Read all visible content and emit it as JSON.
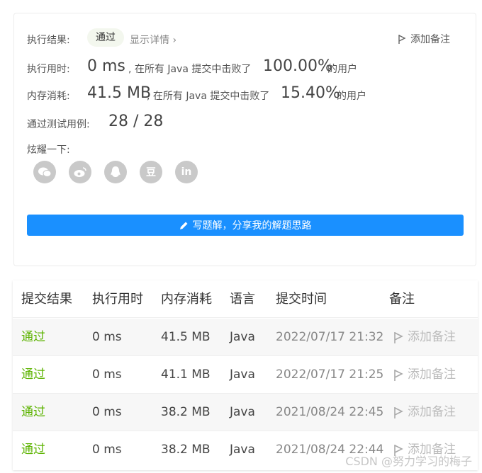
{
  "summary": {
    "result_label": "执行结果:",
    "result_badge": "通过",
    "details_link": "显示详情",
    "add_note": "添加备注",
    "runtime_label": "执行用时:",
    "runtime_value": "0 ms",
    "runtime_text": ", 在所有 Java 提交中击败了",
    "runtime_percent": "100.00%",
    "runtime_suffix": "的用户",
    "memory_label": "内存消耗:",
    "memory_value": "41.5 MB",
    "memory_text": ", 在所有 Java 提交中击败了",
    "memory_percent": "15.40%",
    "memory_suffix": "的用户",
    "tests_label": "通过测试用例:",
    "tests_value": "28 / 28",
    "share_label": "炫耀一下:",
    "share_icons": [
      "wechat-icon",
      "weibo-icon",
      "qq-icon",
      "douban-icon",
      "linkedin-icon"
    ],
    "share_glyphs": [
      "",
      "",
      "",
      "豆",
      "in"
    ],
    "cta_label": "写题解，分享我的解题思路"
  },
  "table": {
    "headers": [
      "提交结果",
      "执行用时",
      "内存消耗",
      "语言",
      "提交时间",
      "备注"
    ],
    "rows": [
      {
        "status": "通过",
        "runtime": "0 ms",
        "memory": "41.5 MB",
        "language": "Java",
        "time": "2022/07/17 21:32",
        "note": "添加备注"
      },
      {
        "status": "通过",
        "runtime": "0 ms",
        "memory": "41.1 MB",
        "language": "Java",
        "time": "2022/07/17 21:25",
        "note": "添加备注"
      },
      {
        "status": "通过",
        "runtime": "0 ms",
        "memory": "38.2 MB",
        "language": "Java",
        "time": "2021/08/24 22:45",
        "note": "添加备注"
      },
      {
        "status": "通过",
        "runtime": "0 ms",
        "memory": "38.2 MB",
        "language": "Java",
        "time": "2021/08/24 22:44",
        "note": "添加备注"
      }
    ]
  },
  "watermark": "CSDN @努力学习的梅子",
  "colors": {
    "accent": "#1a90ff",
    "success": "#5cb300",
    "muted": "#bbbbbb"
  }
}
